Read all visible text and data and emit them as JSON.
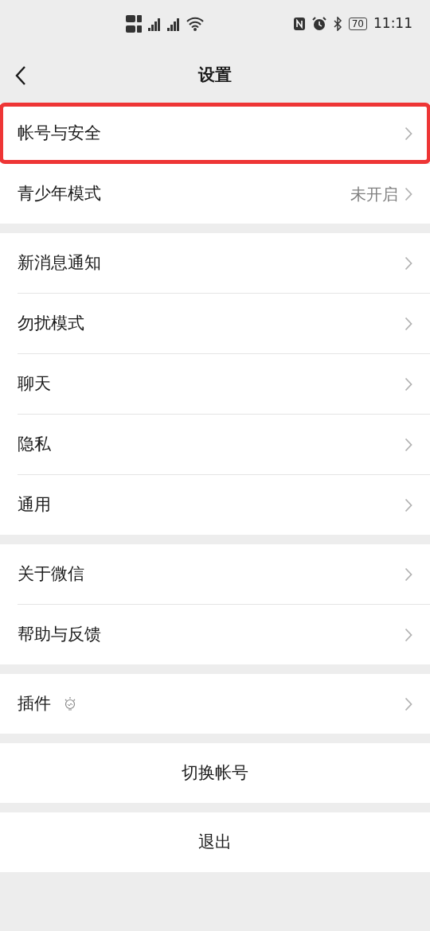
{
  "status_bar": {
    "battery": "70",
    "time": "11:11"
  },
  "header": {
    "title": "设置"
  },
  "groups": [
    {
      "items": [
        {
          "label": "帐号与安全",
          "kind": "nav",
          "highlighted": true
        },
        {
          "label": "青少年模式",
          "kind": "nav",
          "value": "未开启",
          "highlighted": false
        }
      ]
    },
    {
      "items": [
        {
          "label": "新消息通知",
          "kind": "nav",
          "highlighted": false
        },
        {
          "label": "勿扰模式",
          "kind": "nav",
          "highlighted": false
        },
        {
          "label": "聊天",
          "kind": "nav",
          "highlighted": false
        },
        {
          "label": "隐私",
          "kind": "nav",
          "highlighted": false
        },
        {
          "label": "通用",
          "kind": "nav",
          "highlighted": false
        }
      ]
    },
    {
      "items": [
        {
          "label": "关于微信",
          "kind": "nav",
          "highlighted": false
        },
        {
          "label": "帮助与反馈",
          "kind": "nav",
          "highlighted": false
        }
      ]
    },
    {
      "items": [
        {
          "label": "插件",
          "kind": "nav-icon",
          "highlighted": false
        }
      ]
    }
  ],
  "actions": [
    {
      "label": "切换帐号"
    },
    {
      "label": "退出"
    }
  ]
}
